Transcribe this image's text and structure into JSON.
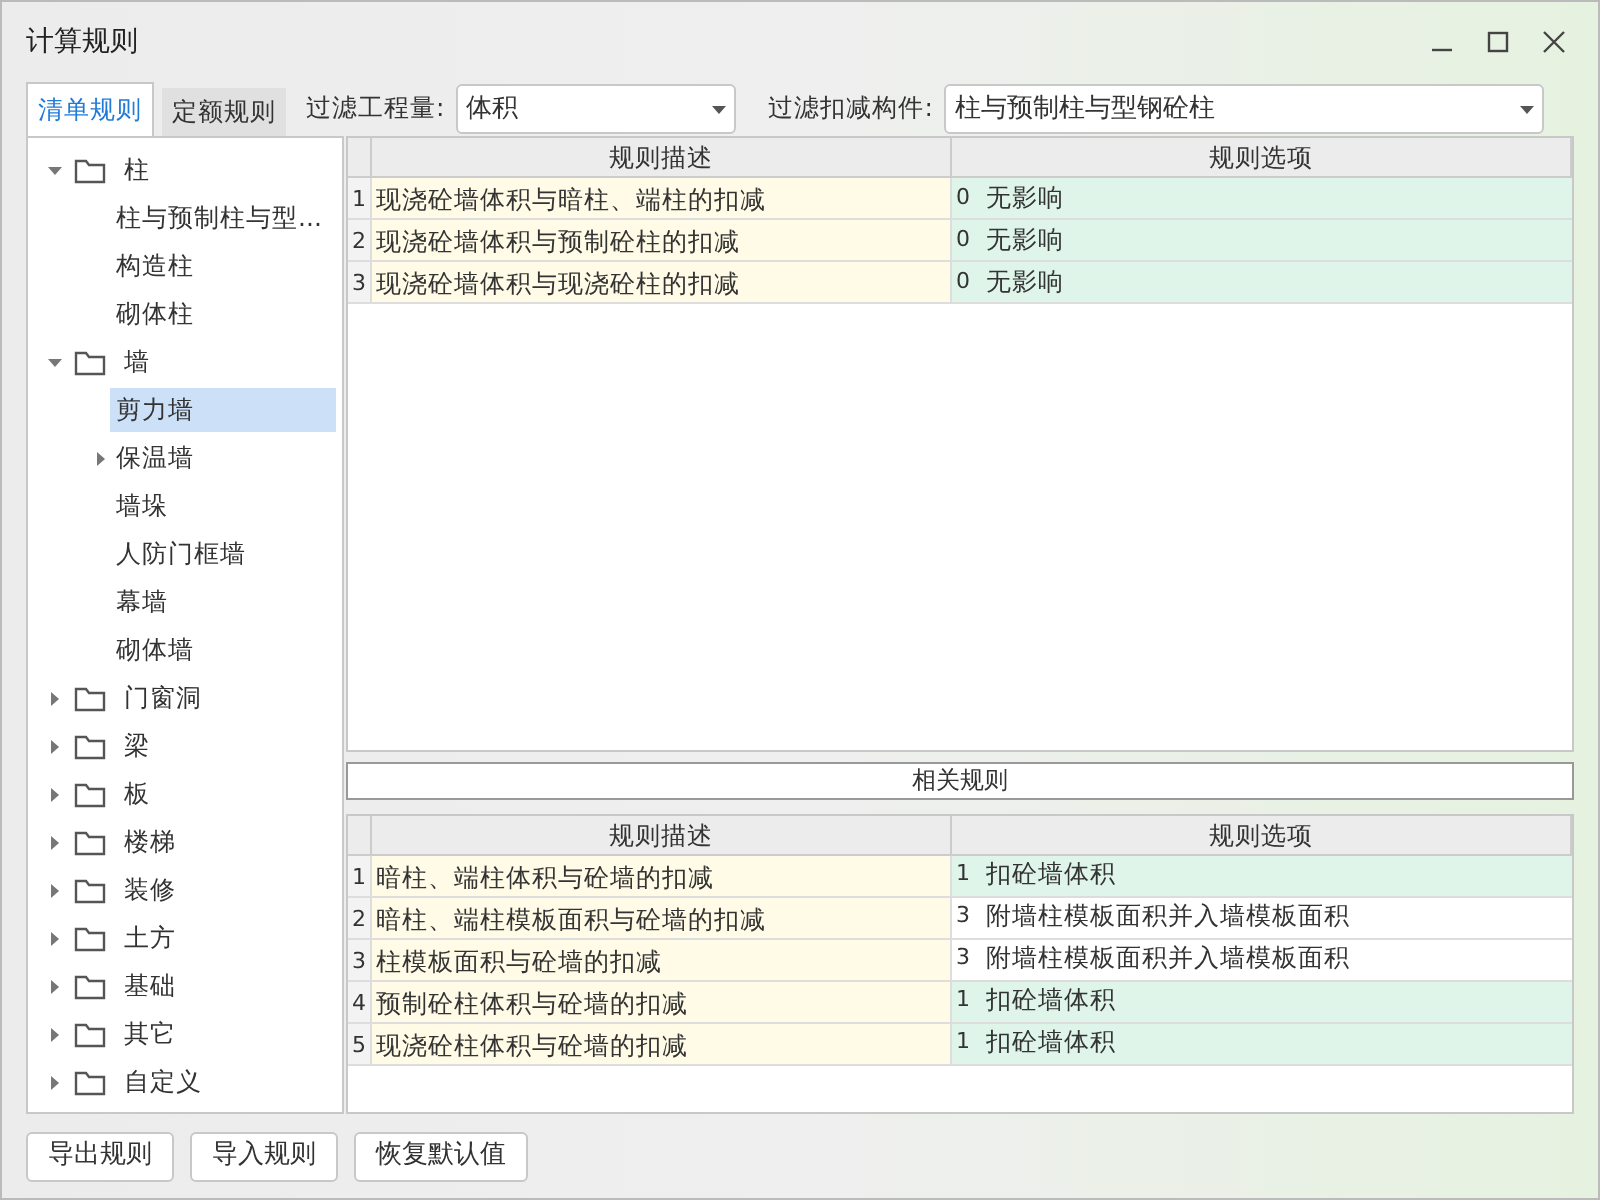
{
  "window": {
    "title": "计算规则"
  },
  "tabs": [
    {
      "label": "清单规则",
      "selected": true
    },
    {
      "label": "定额规则",
      "selected": false
    }
  ],
  "filters": [
    {
      "label": "过滤工程量:",
      "value": "体积"
    },
    {
      "label": "过滤扣减构件:",
      "value": "柱与预制柱与型钢砼柱"
    }
  ],
  "tree": [
    {
      "label": "柱",
      "expanded": true,
      "selected": false,
      "children": [
        {
          "label": "柱与预制柱与型...",
          "kind": "leaf",
          "selected": false
        },
        {
          "label": "构造柱",
          "kind": "leaf",
          "selected": false
        },
        {
          "label": "砌体柱",
          "kind": "leaf",
          "selected": false
        }
      ]
    },
    {
      "label": "墙",
      "expanded": true,
      "selected": false,
      "children": [
        {
          "label": "剪力墙",
          "kind": "leaf",
          "selected": true
        },
        {
          "label": "保温墙",
          "kind": "group",
          "expanded": false,
          "selected": false
        },
        {
          "label": "墙垛",
          "kind": "leaf",
          "selected": false
        },
        {
          "label": "人防门框墙",
          "kind": "leaf",
          "selected": false
        },
        {
          "label": "幕墙",
          "kind": "leaf",
          "selected": false
        },
        {
          "label": "砌体墙",
          "kind": "leaf",
          "selected": false
        }
      ]
    },
    {
      "label": "门窗洞",
      "expanded": false,
      "selected": false
    },
    {
      "label": "梁",
      "expanded": false,
      "selected": false
    },
    {
      "label": "板",
      "expanded": false,
      "selected": false
    },
    {
      "label": "楼梯",
      "expanded": false,
      "selected": false
    },
    {
      "label": "装修",
      "expanded": false,
      "selected": false
    },
    {
      "label": "土方",
      "expanded": false,
      "selected": false
    },
    {
      "label": "基础",
      "expanded": false,
      "selected": false
    },
    {
      "label": "其它",
      "expanded": false,
      "selected": false
    },
    {
      "label": "自定义",
      "expanded": false,
      "selected": false
    }
  ],
  "rules_table": {
    "columns": [
      "规则描述",
      "规则选项"
    ],
    "rows": [
      {
        "number": "1",
        "description": "现浇砼墙体积与暗柱、端柱的扣减",
        "option_code": "0",
        "option": "无影响",
        "highlighted": true
      },
      {
        "number": "2",
        "description": "现浇砼墙体积与预制砼柱的扣减",
        "option_code": "0",
        "option": "无影响",
        "highlighted": true
      },
      {
        "number": "3",
        "description": "现浇砼墙体积与现浇砼柱的扣减",
        "option_code": "0",
        "option": "无影响",
        "highlighted": true
      }
    ]
  },
  "related_title": "相关规则",
  "related_table": {
    "columns": [
      "规则描述",
      "规则选项"
    ],
    "rows": [
      {
        "number": "1",
        "description": "暗柱、端柱体积与砼墙的扣减",
        "option_code": "1",
        "option": "扣砼墙体积",
        "highlighted": true
      },
      {
        "number": "2",
        "description": "暗柱、端柱模板面积与砼墙的扣减",
        "option_code": "3",
        "option": "附墙柱模板面积并入墙模板面积",
        "highlighted": false
      },
      {
        "number": "3",
        "description": "柱模板面积与砼墙的扣减",
        "option_code": "3",
        "option": "附墙柱模板面积并入墙模板面积",
        "highlighted": false
      },
      {
        "number": "4",
        "description": "预制砼柱体积与砼墙的扣减",
        "option_code": "1",
        "option": "扣砼墙体积",
        "highlighted": true
      },
      {
        "number": "5",
        "description": "现浇砼柱体积与砼墙的扣减",
        "option_code": "1",
        "option": "扣砼墙体积",
        "highlighted": true
      }
    ]
  },
  "buttons": [
    "导出规则",
    "导入规则",
    "恢复默认值"
  ]
}
